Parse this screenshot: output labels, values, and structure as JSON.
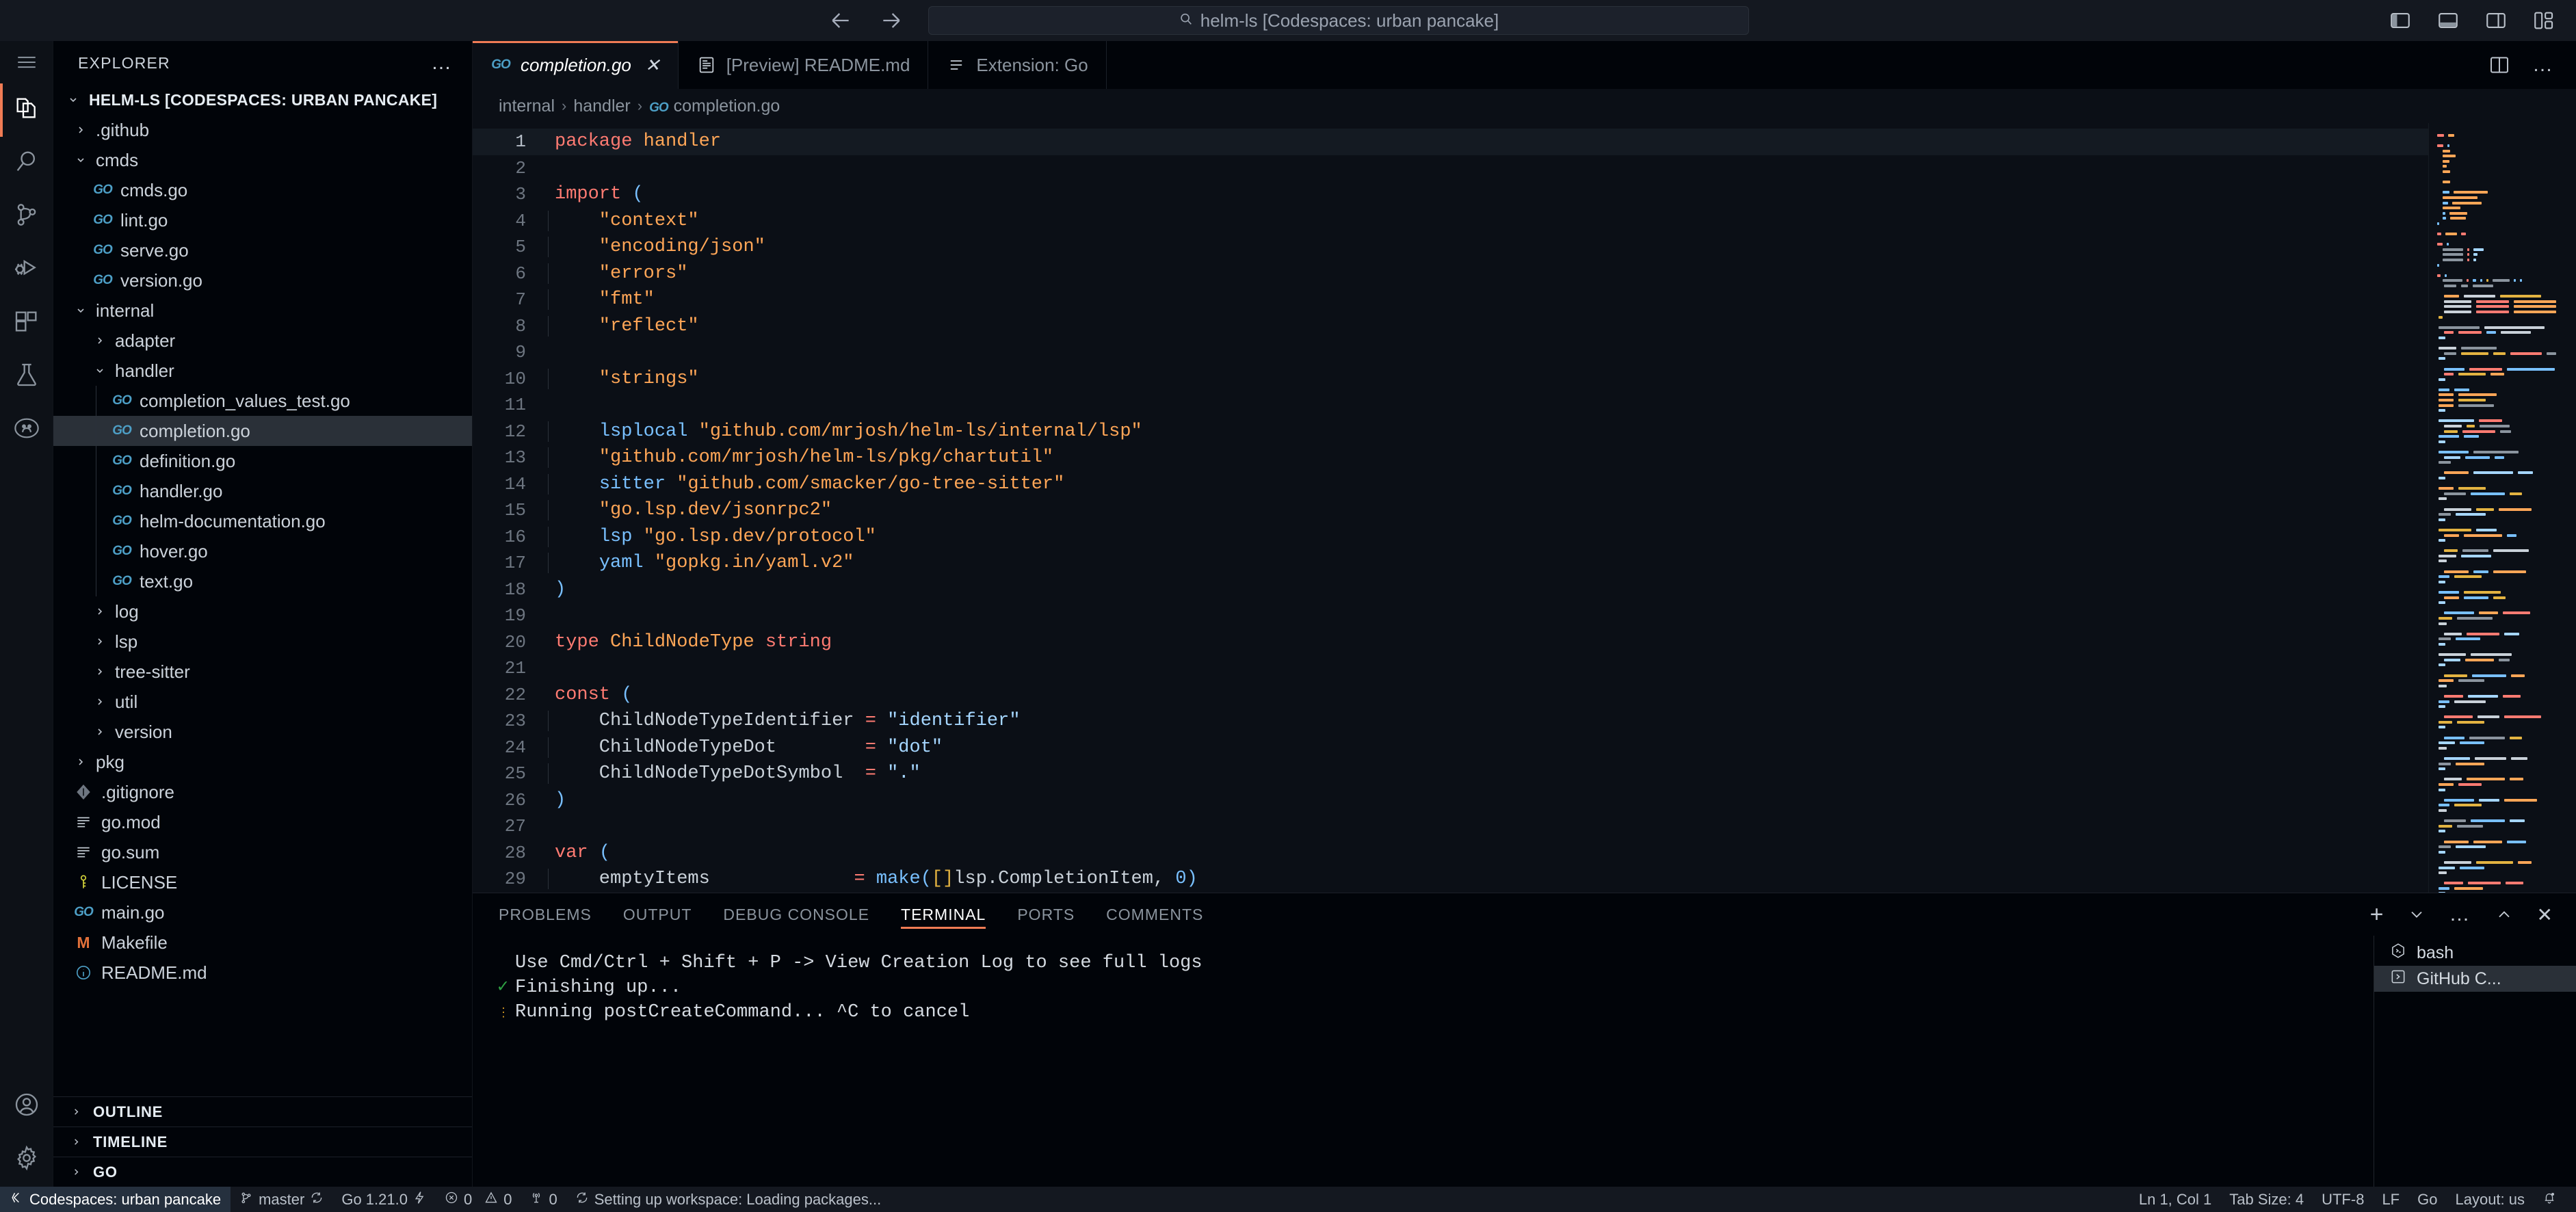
{
  "titlebar": {
    "back_icon": "arrow-left-icon",
    "forward_icon": "arrow-right-icon",
    "search_text": "helm-ls [Codespaces: urban pancake]",
    "layout_icons": [
      "toggle-primary-sidebar-icon",
      "toggle-panel-icon",
      "toggle-secondary-sidebar-icon",
      "customize-layout-icon"
    ]
  },
  "activitybar": {
    "items": [
      {
        "name": "menu",
        "icon": "hamburger-icon",
        "active": false
      },
      {
        "name": "explorer",
        "icon": "files-icon",
        "active": true
      },
      {
        "name": "search",
        "icon": "search-icon",
        "active": false
      },
      {
        "name": "source-control",
        "icon": "source-control-icon",
        "active": false
      },
      {
        "name": "run-and-debug",
        "icon": "run-debug-icon",
        "active": false
      },
      {
        "name": "extensions",
        "icon": "extensions-icon",
        "active": false
      },
      {
        "name": "testing",
        "icon": "beaker-icon",
        "active": false
      },
      {
        "name": "github",
        "icon": "github-icon",
        "active": false
      }
    ],
    "bottom": [
      {
        "name": "accounts",
        "icon": "account-icon"
      },
      {
        "name": "settings",
        "icon": "gear-icon"
      }
    ]
  },
  "sidebar": {
    "title": "EXPLORER",
    "more_actions": "…",
    "root_label": "HELM-LS [CODESPACES: URBAN PANCAKE]",
    "tree": [
      {
        "label": ".github",
        "depth": 1,
        "type": "folder",
        "expanded": false
      },
      {
        "label": "cmds",
        "depth": 1,
        "type": "folder",
        "expanded": true
      },
      {
        "label": "cmds.go",
        "depth": 2,
        "type": "go"
      },
      {
        "label": "lint.go",
        "depth": 2,
        "type": "go"
      },
      {
        "label": "serve.go",
        "depth": 2,
        "type": "go"
      },
      {
        "label": "version.go",
        "depth": 2,
        "type": "go"
      },
      {
        "label": "internal",
        "depth": 1,
        "type": "folder",
        "expanded": true
      },
      {
        "label": "adapter",
        "depth": 2,
        "type": "folder",
        "expanded": false
      },
      {
        "label": "handler",
        "depth": 2,
        "type": "folder",
        "expanded": true
      },
      {
        "label": "completion_values_test.go",
        "depth": 3,
        "type": "go"
      },
      {
        "label": "completion.go",
        "depth": 3,
        "type": "go",
        "selected": true
      },
      {
        "label": "definition.go",
        "depth": 3,
        "type": "go"
      },
      {
        "label": "handler.go",
        "depth": 3,
        "type": "go"
      },
      {
        "label": "helm-documentation.go",
        "depth": 3,
        "type": "go"
      },
      {
        "label": "hover.go",
        "depth": 3,
        "type": "go"
      },
      {
        "label": "text.go",
        "depth": 3,
        "type": "go"
      },
      {
        "label": "log",
        "depth": 2,
        "type": "folder",
        "expanded": false
      },
      {
        "label": "lsp",
        "depth": 2,
        "type": "folder",
        "expanded": false
      },
      {
        "label": "tree-sitter",
        "depth": 2,
        "type": "folder",
        "expanded": false
      },
      {
        "label": "util",
        "depth": 2,
        "type": "folder",
        "expanded": false
      },
      {
        "label": "version",
        "depth": 2,
        "type": "folder",
        "expanded": false
      },
      {
        "label": "pkg",
        "depth": 1,
        "type": "folder",
        "expanded": false
      },
      {
        "label": ".gitignore",
        "depth": 1,
        "type": "git"
      },
      {
        "label": "go.mod",
        "depth": 1,
        "type": "lines"
      },
      {
        "label": "go.sum",
        "depth": 1,
        "type": "lines"
      },
      {
        "label": "LICENSE",
        "depth": 1,
        "type": "license"
      },
      {
        "label": "main.go",
        "depth": 1,
        "type": "go"
      },
      {
        "label": "Makefile",
        "depth": 1,
        "type": "make"
      },
      {
        "label": "README.md",
        "depth": 1,
        "type": "info"
      }
    ],
    "sections": [
      {
        "label": "OUTLINE"
      },
      {
        "label": "TIMELINE"
      },
      {
        "label": "GO"
      }
    ]
  },
  "editor": {
    "tabs": [
      {
        "label": "completion.go",
        "icon": "go-file-icon",
        "active": true,
        "closable": true
      },
      {
        "label": "[Preview] README.md",
        "icon": "preview-icon",
        "active": false,
        "closable": false
      },
      {
        "label": "Extension: Go",
        "icon": "extension-page-icon",
        "active": false,
        "closable": false
      }
    ],
    "close_glyph": "✕",
    "actions": [
      {
        "name": "split-editor",
        "icon": "split-editor-icon"
      },
      {
        "name": "more-actions",
        "icon": "ellipsis-icon",
        "glyph": "…"
      }
    ],
    "breadcrumb": [
      "internal",
      "handler",
      "completion.go"
    ],
    "breadcrumb_separator": "›",
    "code_lines": [
      {
        "n": 1,
        "current": true,
        "indent": 0,
        "tokens": [
          {
            "t": "package ",
            "c": "k"
          },
          {
            "t": "handler",
            "c": "ty"
          }
        ]
      },
      {
        "n": 2,
        "indent": 0,
        "tokens": []
      },
      {
        "n": 3,
        "indent": 0,
        "tokens": [
          {
            "t": "import ",
            "c": "k"
          },
          {
            "t": "(",
            "c": "p"
          }
        ]
      },
      {
        "n": 4,
        "indent": 1,
        "tokens": [
          {
            "t": "    \"context\"",
            "c": "s"
          }
        ]
      },
      {
        "n": 5,
        "indent": 1,
        "tokens": [
          {
            "t": "    \"encoding/json\"",
            "c": "s"
          }
        ]
      },
      {
        "n": 6,
        "indent": 1,
        "tokens": [
          {
            "t": "    \"errors\"",
            "c": "s"
          }
        ]
      },
      {
        "n": 7,
        "indent": 1,
        "tokens": [
          {
            "t": "    \"fmt\"",
            "c": "s"
          }
        ]
      },
      {
        "n": 8,
        "indent": 1,
        "tokens": [
          {
            "t": "    \"reflect\"",
            "c": "s"
          }
        ]
      },
      {
        "n": 9,
        "indent": 1,
        "tokens": []
      },
      {
        "n": 10,
        "indent": 1,
        "tokens": [
          {
            "t": "    \"strings\"",
            "c": "s"
          }
        ]
      },
      {
        "n": 11,
        "indent": 1,
        "tokens": []
      },
      {
        "n": 12,
        "indent": 1,
        "tokens": [
          {
            "t": "    ",
            "c": "pl"
          },
          {
            "t": "lsplocal",
            "c": "id"
          },
          {
            "t": " \"github.com/mrjosh/helm-ls/internal/lsp\"",
            "c": "s"
          }
        ]
      },
      {
        "n": 13,
        "indent": 1,
        "tokens": [
          {
            "t": "    \"github.com/mrjosh/helm-ls/pkg/chartutil\"",
            "c": "s"
          }
        ]
      },
      {
        "n": 14,
        "indent": 1,
        "tokens": [
          {
            "t": "    ",
            "c": "pl"
          },
          {
            "t": "sitter",
            "c": "id"
          },
          {
            "t": " \"github.com/smacker/go-tree-sitter\"",
            "c": "s"
          }
        ]
      },
      {
        "n": 15,
        "indent": 1,
        "tokens": [
          {
            "t": "    \"go.lsp.dev/jsonrpc2\"",
            "c": "s"
          }
        ]
      },
      {
        "n": 16,
        "indent": 1,
        "tokens": [
          {
            "t": "    ",
            "c": "pl"
          },
          {
            "t": "lsp",
            "c": "id"
          },
          {
            "t": " \"go.lsp.dev/protocol\"",
            "c": "s"
          }
        ]
      },
      {
        "n": 17,
        "indent": 1,
        "tokens": [
          {
            "t": "    ",
            "c": "pl"
          },
          {
            "t": "yaml",
            "c": "id"
          },
          {
            "t": " \"gopkg.in/yaml.v2\"",
            "c": "s"
          }
        ]
      },
      {
        "n": 18,
        "indent": 0,
        "tokens": [
          {
            "t": ")",
            "c": "p"
          }
        ]
      },
      {
        "n": 19,
        "indent": 0,
        "tokens": []
      },
      {
        "n": 20,
        "indent": 0,
        "tokens": [
          {
            "t": "type ",
            "c": "k"
          },
          {
            "t": "ChildNodeType",
            "c": "ty"
          },
          {
            "t": " ",
            "c": "pl"
          },
          {
            "t": "string",
            "c": "k"
          }
        ]
      },
      {
        "n": 21,
        "indent": 0,
        "tokens": []
      },
      {
        "n": 22,
        "indent": 0,
        "tokens": [
          {
            "t": "const ",
            "c": "k"
          },
          {
            "t": "(",
            "c": "p"
          }
        ]
      },
      {
        "n": 23,
        "indent": 1,
        "tokens": [
          {
            "t": "    ChildNodeTypeIdentifier ",
            "c": "pl"
          },
          {
            "t": "=",
            "c": "op"
          },
          {
            "t": " \"identifier\"",
            "c": "sb"
          }
        ]
      },
      {
        "n": 24,
        "indent": 1,
        "tokens": [
          {
            "t": "    ChildNodeTypeDot        ",
            "c": "pl"
          },
          {
            "t": "=",
            "c": "op"
          },
          {
            "t": " \"dot\"",
            "c": "sb"
          }
        ]
      },
      {
        "n": 25,
        "indent": 1,
        "tokens": [
          {
            "t": "    ChildNodeTypeDotSymbol  ",
            "c": "pl"
          },
          {
            "t": "=",
            "c": "op"
          },
          {
            "t": " \".\"",
            "c": "sb"
          }
        ]
      },
      {
        "n": 26,
        "indent": 0,
        "tokens": [
          {
            "t": ")",
            "c": "p"
          }
        ]
      },
      {
        "n": 27,
        "indent": 0,
        "tokens": []
      },
      {
        "n": 28,
        "indent": 0,
        "tokens": [
          {
            "t": "var ",
            "c": "k"
          },
          {
            "t": "(",
            "c": "p"
          }
        ]
      },
      {
        "n": 29,
        "indent": 1,
        "tokens": [
          {
            "t": "    emptyItems             ",
            "c": "pl"
          },
          {
            "t": "=",
            "c": "op"
          },
          {
            "t": " ",
            "c": "pl"
          },
          {
            "t": "make",
            "c": "id"
          },
          {
            "t": "(",
            "c": "p"
          },
          {
            "t": "[]",
            "c": "y"
          },
          {
            "t": "lsp.CompletionItem, ",
            "c": "pl"
          },
          {
            "t": "0",
            "c": "id"
          },
          {
            "t": ")",
            "c": "p"
          }
        ]
      }
    ]
  },
  "panel": {
    "tabs": [
      {
        "label": "PROBLEMS",
        "active": false
      },
      {
        "label": "OUTPUT",
        "active": false
      },
      {
        "label": "DEBUG CONSOLE",
        "active": false
      },
      {
        "label": "TERMINAL",
        "active": true
      },
      {
        "label": "PORTS",
        "active": false
      },
      {
        "label": "COMMENTS",
        "active": false
      }
    ],
    "actions": [
      {
        "name": "new-terminal",
        "icon": "plus-icon",
        "glyph": "+"
      },
      {
        "name": "terminal-profile",
        "icon": "chevron-down-icon"
      },
      {
        "name": "views-and-more",
        "icon": "ellipsis-icon",
        "glyph": "…"
      },
      {
        "name": "maximize-panel",
        "icon": "chevron-up-icon"
      },
      {
        "name": "close-panel",
        "icon": "close-icon",
        "glyph": "✕"
      }
    ],
    "terminal_lines": [
      {
        "mark": "",
        "mark_kind": "none",
        "text": "Use Cmd/Ctrl + Shift + P -> View Creation Log to see full logs"
      },
      {
        "mark": "✓",
        "mark_kind": "ok",
        "text": "Finishing up..."
      },
      {
        "mark": "⋮",
        "mark_kind": "spin",
        "text": "Running postCreateCommand... ^C to cancel"
      }
    ],
    "terminal_list": [
      {
        "label": "bash",
        "icon": "terminal-bash-icon",
        "active": false
      },
      {
        "label": "GitHub C...",
        "icon": "terminal-chevron-icon",
        "active": true
      }
    ]
  },
  "statusbar": {
    "remote": {
      "label": "Codespaces: urban pancake",
      "icon": "remote-icon"
    },
    "left_items": [
      {
        "label": "master",
        "icon": "source-control-icon",
        "trailing_icon": "sync-icon"
      },
      {
        "label": "Go 1.21.0",
        "icon": "",
        "trailing_icon": "go-power-icon"
      },
      {
        "label": "0",
        "icon": "error-icon"
      },
      {
        "label": "0",
        "icon": "warning-icon"
      },
      {
        "label": "0",
        "icon": "radio-tower-icon"
      },
      {
        "label": "Setting up workspace: Loading packages...",
        "icon": "loading-icon"
      }
    ],
    "right_items": [
      {
        "label": "Ln 1, Col 1"
      },
      {
        "label": "Tab Size: 4"
      },
      {
        "label": "UTF-8"
      },
      {
        "label": "LF"
      },
      {
        "label": "Go"
      },
      {
        "label": "Layout: us"
      }
    ],
    "bell_icon": "bell-dot-icon"
  },
  "colors": {
    "accent": "#f07c55",
    "remote_bg": "#25303e",
    "editor_bg": "#0b0f16",
    "sidebar_bg": "#010409",
    "titlebar_bg": "#141820",
    "go_icon": "#4d9fc6",
    "selection_bg": "#2a3038"
  }
}
